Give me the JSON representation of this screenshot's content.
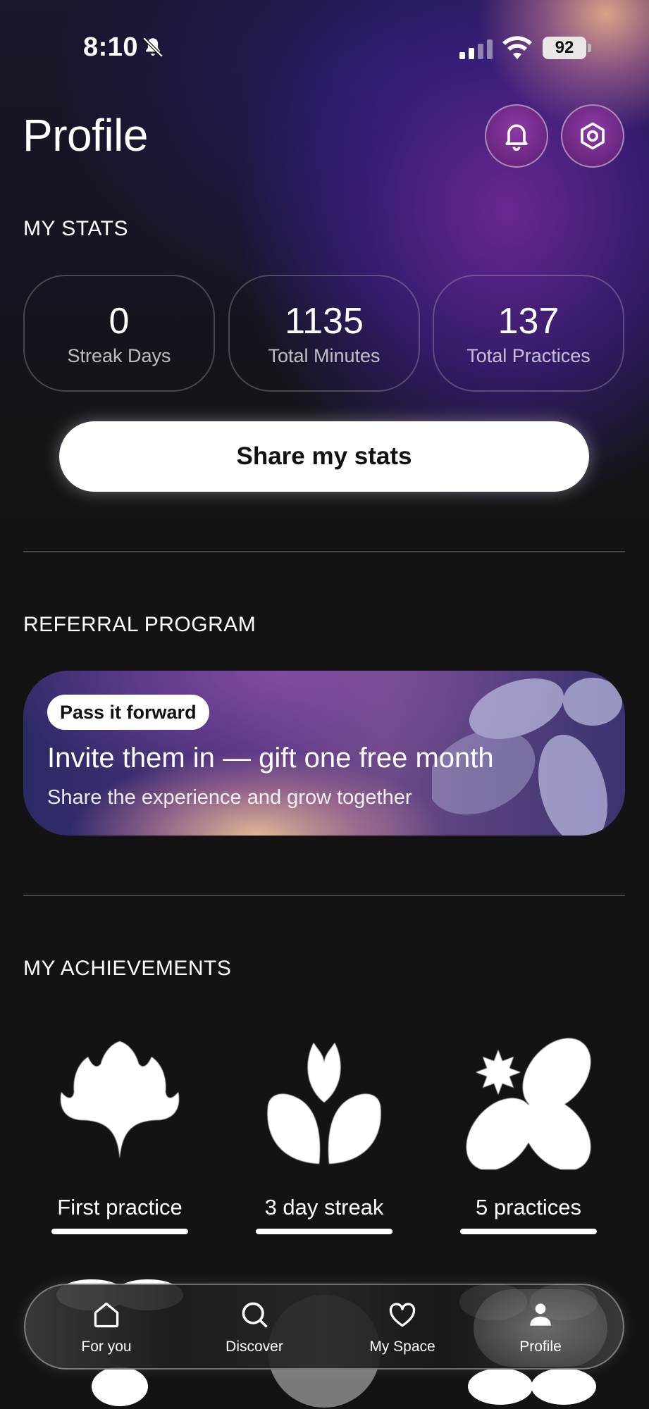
{
  "status_bar": {
    "time": "8:10",
    "battery": "92"
  },
  "header": {
    "title": "Profile"
  },
  "stats": {
    "section_label": "MY STATS",
    "items": [
      {
        "value": "0",
        "label": "Streak Days"
      },
      {
        "value": "1135",
        "label": "Total Minutes"
      },
      {
        "value": "137",
        "label": "Total Practices"
      }
    ],
    "share_label": "Share my stats"
  },
  "referral": {
    "section_label": "REFERRAL PROGRAM",
    "pill": "Pass it forward",
    "title": "Invite them in — gift one free month",
    "subtitle": "Share the experience and grow together"
  },
  "achievements": {
    "section_label": "MY ACHIEVEMENTS",
    "items": [
      {
        "label": "First practice",
        "icon": "ginkgo-leaf-icon",
        "progress": 1.0
      },
      {
        "label": "3 day streak",
        "icon": "sprout-petals-icon",
        "progress": 1.0
      },
      {
        "label": "5 practices",
        "icon": "star-petals-icon",
        "progress": 1.0
      }
    ]
  },
  "tabbar": {
    "items": [
      {
        "label": "For you",
        "icon": "home-icon"
      },
      {
        "label": "Discover",
        "icon": "search-icon"
      },
      {
        "label": "My Space",
        "icon": "heart-icon"
      },
      {
        "label": "Profile",
        "icon": "person-icon",
        "active": true
      }
    ]
  }
}
